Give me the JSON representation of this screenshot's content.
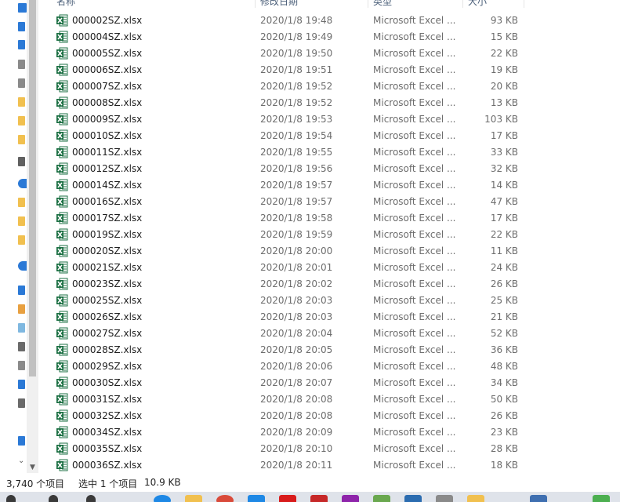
{
  "columns": {
    "name": "名称",
    "date": "修改日期",
    "type": "类型",
    "size": "大小"
  },
  "nav_icons": [
    "pin-icon",
    "folder-icon",
    "download-icon",
    "document-icon",
    "picture-icon",
    "folder-icon",
    "folder-icon",
    "folder-icon",
    "usb-drive-icon",
    "onedrive-icon",
    "folder-icon",
    "folder-icon",
    "folder-icon",
    "cloud-icon",
    "this-pc-icon",
    "objects-icon",
    "video-icon",
    "picture-icon",
    "document-icon",
    "download-icon",
    "music-icon",
    "desktop-icon",
    "chevron-down-icon"
  ],
  "files": [
    {
      "name": "000002SZ.xlsx",
      "date": "2020/1/8 19:48",
      "type": "Microsoft Excel ...",
      "size": "93 KB"
    },
    {
      "name": "000004SZ.xlsx",
      "date": "2020/1/8 19:49",
      "type": "Microsoft Excel ...",
      "size": "15 KB"
    },
    {
      "name": "000005SZ.xlsx",
      "date": "2020/1/8 19:50",
      "type": "Microsoft Excel ...",
      "size": "22 KB"
    },
    {
      "name": "000006SZ.xlsx",
      "date": "2020/1/8 19:51",
      "type": "Microsoft Excel ...",
      "size": "19 KB"
    },
    {
      "name": "000007SZ.xlsx",
      "date": "2020/1/8 19:52",
      "type": "Microsoft Excel ...",
      "size": "20 KB"
    },
    {
      "name": "000008SZ.xlsx",
      "date": "2020/1/8 19:52",
      "type": "Microsoft Excel ...",
      "size": "13 KB"
    },
    {
      "name": "000009SZ.xlsx",
      "date": "2020/1/8 19:53",
      "type": "Microsoft Excel ...",
      "size": "103 KB"
    },
    {
      "name": "000010SZ.xlsx",
      "date": "2020/1/8 19:54",
      "type": "Microsoft Excel ...",
      "size": "17 KB"
    },
    {
      "name": "000011SZ.xlsx",
      "date": "2020/1/8 19:55",
      "type": "Microsoft Excel ...",
      "size": "33 KB"
    },
    {
      "name": "000012SZ.xlsx",
      "date": "2020/1/8 19:56",
      "type": "Microsoft Excel ...",
      "size": "32 KB"
    },
    {
      "name": "000014SZ.xlsx",
      "date": "2020/1/8 19:57",
      "type": "Microsoft Excel ...",
      "size": "14 KB"
    },
    {
      "name": "000016SZ.xlsx",
      "date": "2020/1/8 19:57",
      "type": "Microsoft Excel ...",
      "size": "47 KB"
    },
    {
      "name": "000017SZ.xlsx",
      "date": "2020/1/8 19:58",
      "type": "Microsoft Excel ...",
      "size": "17 KB"
    },
    {
      "name": "000019SZ.xlsx",
      "date": "2020/1/8 19:59",
      "type": "Microsoft Excel ...",
      "size": "22 KB"
    },
    {
      "name": "000020SZ.xlsx",
      "date": "2020/1/8 20:00",
      "type": "Microsoft Excel ...",
      "size": "11 KB"
    },
    {
      "name": "000021SZ.xlsx",
      "date": "2020/1/8 20:01",
      "type": "Microsoft Excel ...",
      "size": "24 KB"
    },
    {
      "name": "000023SZ.xlsx",
      "date": "2020/1/8 20:02",
      "type": "Microsoft Excel ...",
      "size": "26 KB"
    },
    {
      "name": "000025SZ.xlsx",
      "date": "2020/1/8 20:03",
      "type": "Microsoft Excel ...",
      "size": "25 KB"
    },
    {
      "name": "000026SZ.xlsx",
      "date": "2020/1/8 20:03",
      "type": "Microsoft Excel ...",
      "size": "21 KB"
    },
    {
      "name": "000027SZ.xlsx",
      "date": "2020/1/8 20:04",
      "type": "Microsoft Excel ...",
      "size": "52 KB"
    },
    {
      "name": "000028SZ.xlsx",
      "date": "2020/1/8 20:05",
      "type": "Microsoft Excel ...",
      "size": "36 KB"
    },
    {
      "name": "000029SZ.xlsx",
      "date": "2020/1/8 20:06",
      "type": "Microsoft Excel ...",
      "size": "48 KB"
    },
    {
      "name": "000030SZ.xlsx",
      "date": "2020/1/8 20:07",
      "type": "Microsoft Excel ...",
      "size": "34 KB"
    },
    {
      "name": "000031SZ.xlsx",
      "date": "2020/1/8 20:08",
      "type": "Microsoft Excel ...",
      "size": "50 KB"
    },
    {
      "name": "000032SZ.xlsx",
      "date": "2020/1/8 20:08",
      "type": "Microsoft Excel ...",
      "size": "26 KB"
    },
    {
      "name": "000034SZ.xlsx",
      "date": "2020/1/8 20:09",
      "type": "Microsoft Excel ...",
      "size": "23 KB"
    },
    {
      "name": "000035SZ.xlsx",
      "date": "2020/1/8 20:10",
      "type": "Microsoft Excel ...",
      "size": "28 KB"
    },
    {
      "name": "000036SZ.xlsx",
      "date": "2020/1/8 20:11",
      "type": "Microsoft Excel ...",
      "size": "18 KB"
    }
  ],
  "status": {
    "item_count": "3,740 个项目",
    "selection": "选中 1 个项目",
    "selection_size": "10.9 KB"
  },
  "taskbar_icons": [
    "windows-start-icon",
    "search-icon",
    "task-view-icon",
    "edge-browser-icon",
    "file-explorer-icon",
    "chrome-icon",
    "app-icon",
    "app-icon",
    "app-icon",
    "app-icon",
    "app-icon",
    "app-icon",
    "app-icon",
    "app-icon",
    "app-icon",
    "app-icon"
  ],
  "colors": {
    "excel_green": "#1e7145",
    "scroll_thumb": "#c1c1c1",
    "taskbar": "#dfe3ea"
  }
}
